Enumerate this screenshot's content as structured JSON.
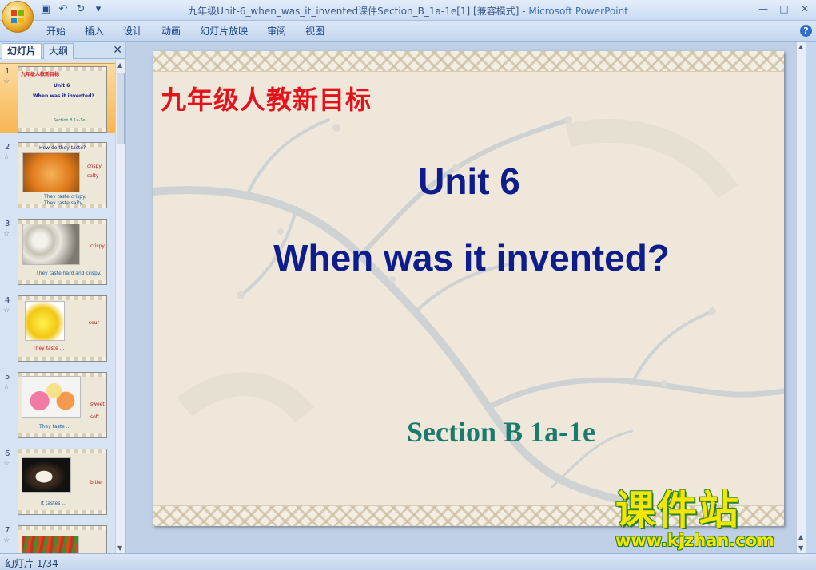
{
  "window": {
    "title": "九年级Unit-6_when_was_it_invented课件Section_B_1a-1e[1] [兼容模式]",
    "app_name": "Microsoft PowerPoint",
    "title_separator": "-"
  },
  "qat": {
    "save_icon": "save-icon",
    "undo_icon": "undo-icon",
    "redo_icon": "redo-icon",
    "customize_icon": "customize-qat-icon"
  },
  "ribbon": {
    "tabs": [
      "开始",
      "插入",
      "设计",
      "动画",
      "幻灯片放映",
      "审阅",
      "视图"
    ]
  },
  "panel": {
    "tab_slides": "幻灯片",
    "tab_outline": "大纲",
    "close": "✕",
    "thumbnails": [
      {
        "num": "1",
        "title": "Unit 6",
        "subtitle": "When was it invented?",
        "tag": "九年级人教新目标",
        "note": "Section B 1a-1e"
      },
      {
        "num": "2",
        "title": "How do they taste?",
        "w1": "crispy",
        "w2": "salty",
        "caption": "They taste crispy.",
        "caption2": "They taste salty."
      },
      {
        "num": "3",
        "w1": "crispy",
        "caption": "They taste hard and crispy."
      },
      {
        "num": "4",
        "w1": "sour",
        "caption": "They taste ..."
      },
      {
        "num": "5",
        "w1": "sweet",
        "w2": "soft",
        "caption": "They taste ..."
      },
      {
        "num": "6",
        "w1": "bitter",
        "caption": "It tastes ..."
      },
      {
        "num": "7"
      }
    ]
  },
  "slide": {
    "tag": "九年级人教新目标",
    "unit": "Unit 6",
    "question": "When was it invented?",
    "section": "Section B 1a-1e",
    "colors": {
      "tag": "#e5121b",
      "heading": "#0d1d8c",
      "section": "#1b7a6e"
    }
  },
  "watermark": {
    "cn": "课件站",
    "url": "www.kjzhan.com"
  },
  "status": {
    "slide_counter": "幻灯片 1/34"
  }
}
